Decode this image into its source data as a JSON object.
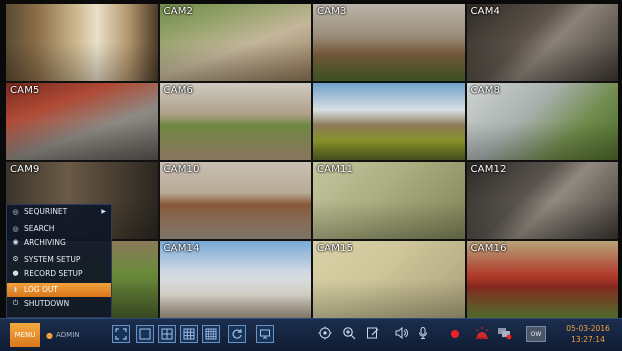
{
  "cameras": [
    {
      "label": "",
      "scene": "s1"
    },
    {
      "label": "CAM2",
      "scene": "s2"
    },
    {
      "label": "CAM3",
      "scene": "s3"
    },
    {
      "label": "CAM4",
      "scene": "s4"
    },
    {
      "label": "CAM5",
      "scene": "s5"
    },
    {
      "label": "CAM6",
      "scene": "s6"
    },
    {
      "label": "",
      "scene": "s7"
    },
    {
      "label": "CAM8",
      "scene": "s8"
    },
    {
      "label": "CAM9",
      "scene": "s9"
    },
    {
      "label": "CAM10",
      "scene": "s10"
    },
    {
      "label": "CAM11",
      "scene": "s11"
    },
    {
      "label": "CAM12",
      "scene": "s12"
    },
    {
      "label": "",
      "scene": "s13"
    },
    {
      "label": "CAM14",
      "scene": "s14"
    },
    {
      "label": "CAM15",
      "scene": "s15"
    },
    {
      "label": "CAM16",
      "scene": "s16"
    }
  ],
  "menu": {
    "items": [
      {
        "label": "SEQURINET",
        "icon": "search-icon",
        "submenu": true
      },
      {
        "label": "SEARCH",
        "icon": "search-icon"
      },
      {
        "label": "ARCHIVING",
        "icon": "archive-icon"
      },
      {
        "label": "SYSTEM SETUP",
        "icon": "gear-icon"
      },
      {
        "label": "RECORD SETUP",
        "icon": "record-icon"
      },
      {
        "label": "LOG OUT",
        "icon": "logout-icon",
        "active": true
      },
      {
        "label": "SHUTDOWN",
        "icon": "power-icon"
      }
    ]
  },
  "toolbar": {
    "menu_label": "MENU",
    "user": "ADMIN",
    "status_label": "OW",
    "date": "05-03-2016",
    "time": "13:27:14"
  },
  "colors": {
    "accent": "#f2a13b",
    "toolbar_bg": "#132541",
    "record": "#e22222"
  }
}
